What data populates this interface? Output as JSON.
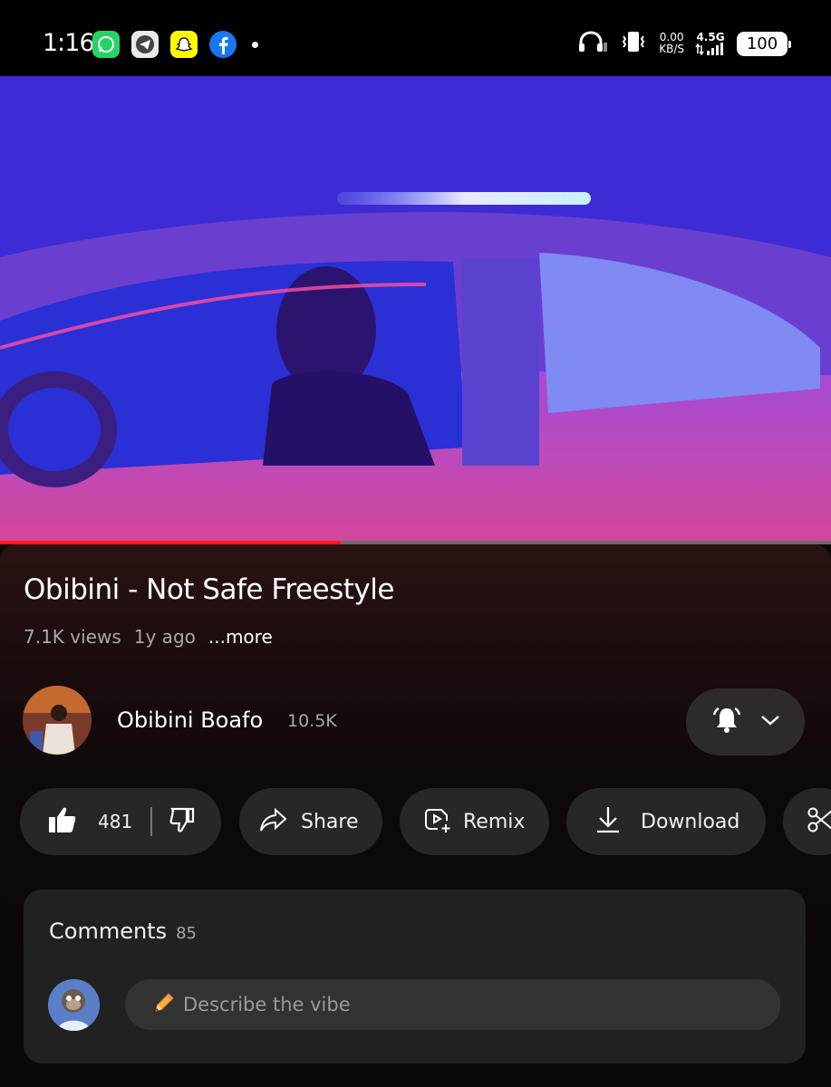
{
  "status_bar": {
    "time": "1:16",
    "net_speed_value": "0.00",
    "net_speed_unit": "KB/S",
    "network_type": "4.5G",
    "battery": "100",
    "app_icons": [
      "whatsapp-icon",
      "telegram-icon",
      "snapchat-icon",
      "facebook-icon"
    ]
  },
  "video": {
    "progress_fraction": 0.41
  },
  "details": {
    "title": "Obibini - Not Safe Freestyle",
    "views": "7.1K views",
    "age": "1y ago",
    "more": "...more"
  },
  "channel": {
    "name": "Obibini Boafo",
    "subscribers": "10.5K"
  },
  "actions": {
    "like_count": "481",
    "share": "Share",
    "remix": "Remix",
    "download": "Download"
  },
  "comments": {
    "title": "Comments",
    "count": "85",
    "placeholder": "Describe the vibe"
  },
  "colors": {
    "accent_red": "#ff1a1a",
    "pill_bg": "#272727",
    "comments_bg": "#212121"
  }
}
